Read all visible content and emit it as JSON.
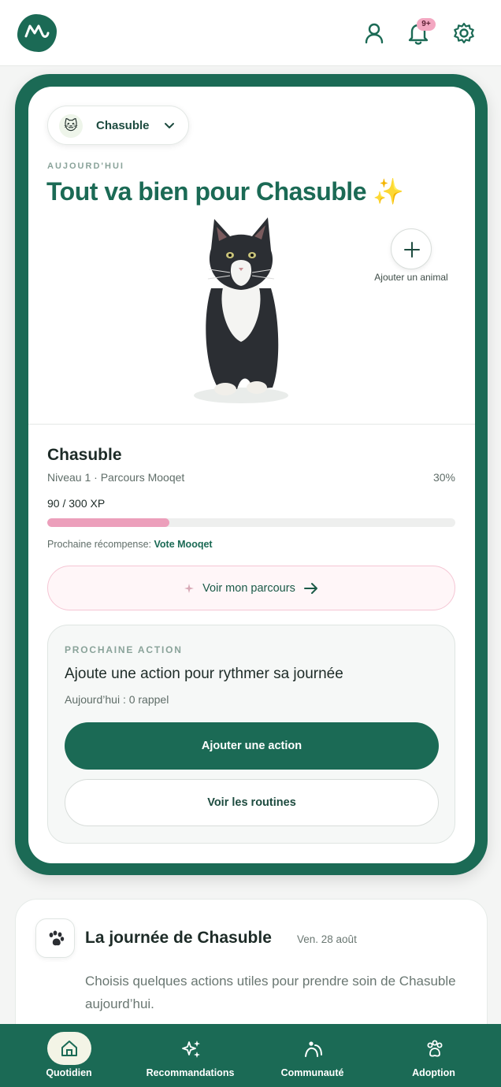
{
  "header": {
    "logo_icon": "mooqet-logo-icon",
    "notifications_badge": "9+"
  },
  "hero": {
    "pet_selector": {
      "avatar_emoji": "🐱",
      "name": "Chasuble"
    },
    "eyebrow": "AUJOURD'HUI",
    "title": "Tout va bien pour Chasuble",
    "title_emoji": "✨",
    "add_animal_label": "Ajouter un animal"
  },
  "pet": {
    "name": "Chasuble",
    "subtitle": "Niveau 1 · Parcours Mooqet",
    "percent": "30%",
    "progress_fraction": 0.3,
    "xp": "90 / 300 XP",
    "reward_prefix": "Prochaine récompense:",
    "reward_name": "Vote Mooqet",
    "parcours_button": "Voir mon parcours"
  },
  "next_action": {
    "eyebrow": "PROCHAINE ACTION",
    "title": "Ajoute une action pour rythmer sa journée",
    "subtitle": "Aujourd’hui : 0 rappel",
    "primary_button": "Ajouter une action",
    "secondary_button": "Voir les routines"
  },
  "day": {
    "title": "La journée de Chasuble",
    "date": "Ven. 28 août",
    "description": "Choisis quelques actions utiles pour prendre soin de Chasuble aujourd’hui."
  },
  "tabs": [
    {
      "label": "Quotidien",
      "icon": "home-icon",
      "active": true
    },
    {
      "label": "Recommandations",
      "icon": "sparkles-icon",
      "active": false
    },
    {
      "label": "Communauté",
      "icon": "community-icon",
      "active": false
    },
    {
      "label": "Adoption",
      "icon": "paw-icon",
      "active": false
    }
  ],
  "colors": {
    "brand_green": "#1b6a55",
    "progress_pink": "#ec9fbb",
    "badge_pink": "#f3a7c1"
  }
}
